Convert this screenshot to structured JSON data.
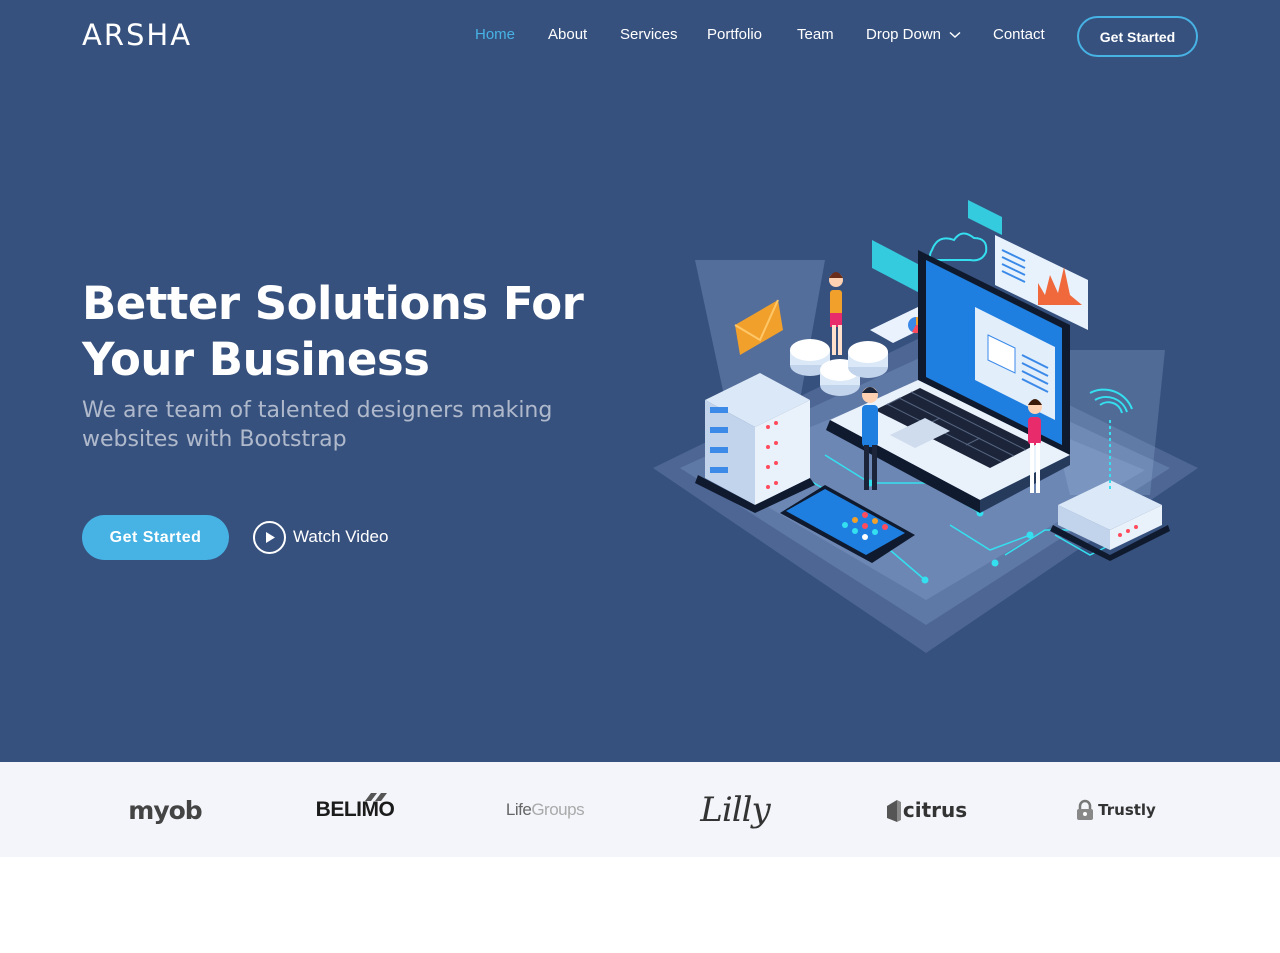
{
  "header": {
    "logo": "ARSHA",
    "nav": [
      {
        "label": "Home",
        "active": true
      },
      {
        "label": "About"
      },
      {
        "label": "Services"
      },
      {
        "label": "Portfolio"
      },
      {
        "label": "Team"
      },
      {
        "label": "Drop Down",
        "icon": "chevron-down-icon"
      },
      {
        "label": "Contact"
      }
    ],
    "cta_label": "Get Started"
  },
  "hero": {
    "title_line1": "Better Solutions For",
    "title_line2": "Your Business",
    "subtitle": "We are team of talented designers making websites with Bootstrap",
    "primary_button": "Get Started",
    "video_label": "Watch Video",
    "video_icon": "play-icon"
  },
  "clients": [
    {
      "name": "myob"
    },
    {
      "name": "BELIMO"
    },
    {
      "name_part1": "Life",
      "name_part2": "Groups"
    },
    {
      "name": "Lilly"
    },
    {
      "name": "citrus"
    },
    {
      "name": "Trustly"
    }
  ],
  "colors": {
    "hero_bg": "#37517e",
    "accent": "#47b2e4",
    "clients_bg": "#f3f5fa"
  }
}
